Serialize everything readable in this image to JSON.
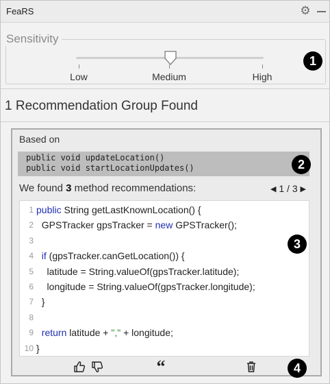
{
  "window": {
    "title": "FeaRS"
  },
  "icons": {
    "settings": "gear-icon",
    "minimize": "minimize-icon"
  },
  "sensitivity": {
    "label": "Sensitivity",
    "level": 0.5,
    "ticks": [
      "Low",
      "Medium",
      "High"
    ],
    "selected": "Medium"
  },
  "badges": [
    "1",
    "2",
    "3",
    "4"
  ],
  "group": {
    "title": "1 Recommendation Group Found"
  },
  "based_on": {
    "label": "Based on",
    "methods": [
      "public void updateLocation()",
      "public void startLocationUpdates()"
    ]
  },
  "found": {
    "prefix": "We found ",
    "count": "3",
    "suffix": " method recommendations:"
  },
  "pager": {
    "text": "1 / 3"
  },
  "code": {
    "lines": [
      {
        "n": "1",
        "html": "<span class=\"kw\">public</span> String getLastKnownLocation() {"
      },
      {
        "n": "2",
        "html": "  GPSTracker gpsTracker = <span class=\"kw\">new</span> GPSTracker();"
      },
      {
        "n": "3",
        "html": ""
      },
      {
        "n": "4",
        "html": "  <span class=\"kw\">if</span> (gpsTracker.canGetLocation()) {"
      },
      {
        "n": "5",
        "html": "    latitude = String.valueOf(gpsTracker.latitude);"
      },
      {
        "n": "6",
        "html": "    longitude = String.valueOf(gpsTracker.longitude);"
      },
      {
        "n": "7",
        "html": "  }"
      },
      {
        "n": "8",
        "html": ""
      },
      {
        "n": "9",
        "html": "  <span class=\"kw\">return</span> latitude + <span class=\"str\">\",\"</span> + longitude;"
      },
      {
        "n": "10",
        "html": "}"
      }
    ]
  },
  "actions": {
    "thumbs_up": "thumbs-up-icon",
    "thumbs_down": "thumbs-down-icon",
    "quote": "quote-icon",
    "delete": "trash-icon"
  }
}
